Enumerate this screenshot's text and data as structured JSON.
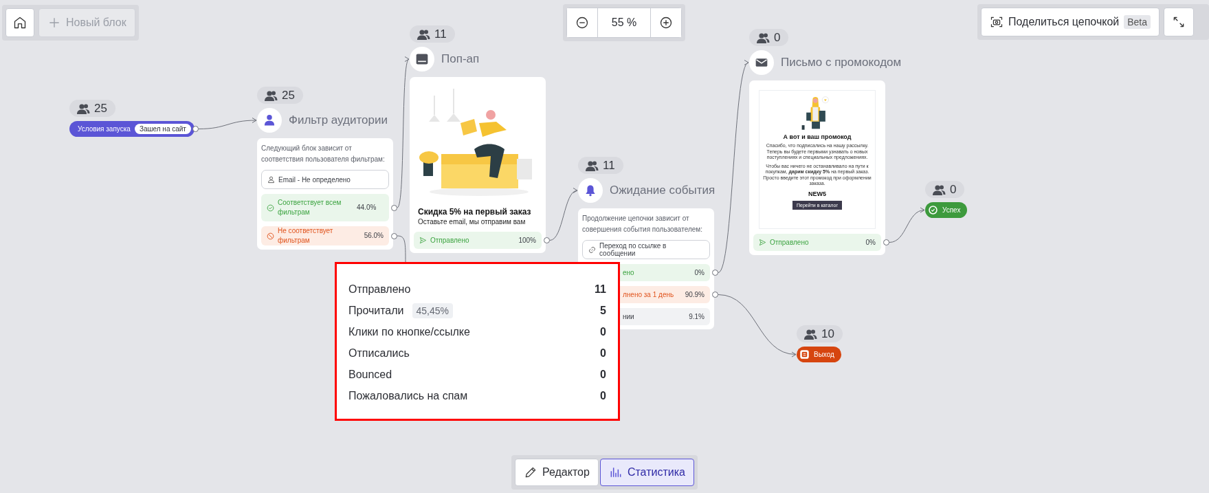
{
  "toolbar": {
    "new_block_button": {
      "label": "Новый блок",
      "disabled": true
    }
  },
  "zoom": {
    "value": "55 %"
  },
  "share": {
    "label": "Поделиться цепочкой",
    "badge": "Beta"
  },
  "nodes": [
    {
      "kind": "start",
      "count": "25",
      "label": "Условия запуска",
      "tag": "Зашел на сайт"
    },
    {
      "kind": "filter",
      "count": "25",
      "title": "Фильтр аудитории",
      "description": "Следующий блок зависит от соответствия пользователя фильтрам:",
      "condition": "Email - Не определено",
      "outcomes": [
        {
          "kind": "match",
          "label": "Соответствует всем фильтрам",
          "percent": "44.0%"
        },
        {
          "kind": "nomatch",
          "label": "Не соответствует фильтрам",
          "percent": "56.0%"
        }
      ]
    },
    {
      "kind": "popup",
      "count": "11",
      "title": "Поп-ап",
      "preview": {
        "kind": "picture",
        "heading": "Скидка 5% на первый заказ",
        "text": "Оставьте email, мы отправим вам"
      },
      "outcomes": [
        {
          "kind": "sent",
          "label": "Отправлено",
          "percent": "100%"
        }
      ]
    },
    {
      "kind": "wait",
      "count": "11",
      "title": "Ожидание события",
      "description": "Продолжение цепочки зависит от совершения события пользователем:",
      "condition": "Переход по ссылке в сообщении",
      "outcomes": [
        {
          "kind": "done",
          "label": "ено",
          "percent": "0%"
        },
        {
          "kind": "timeout",
          "label": "лнено за 1 день",
          "percent": "90.9%"
        },
        {
          "kind": "other",
          "label": "нии",
          "percent": "9.1%"
        }
      ]
    },
    {
      "kind": "email",
      "count": "0",
      "title": "Письмо с промокодом",
      "preview": {
        "kind": "picture",
        "heading": "А вот и ваш промокод",
        "paragraphs": [
          "Спасибо, что подписались на нашу рассылку. Теперь вы будете первыми узнавать о новых поступлениях и специальных предложениях.",
          "Чтобы вас ничего не останавливало на пути к покупкам, **дарим скидку 5%** на первый заказ. Просто введите этот промокод при оформлении заказа."
        ],
        "code": "NEW5",
        "button": "Перейти в каталог"
      },
      "outcomes": [
        {
          "kind": "sent",
          "label": "Отправлено",
          "percent": "0%"
        }
      ]
    },
    {
      "kind": "success",
      "count": "0",
      "label": "Успех"
    },
    {
      "kind": "exit",
      "count": "10",
      "label": "Выход"
    }
  ],
  "stats_popup": {
    "rows": [
      {
        "label": "Отправлено",
        "value": "11"
      },
      {
        "label": "Прочитали",
        "chip": "45,45%",
        "value": "5"
      },
      {
        "label": "Клики по кнопке/ссылке",
        "value": "0"
      },
      {
        "label": "Отписались",
        "value": "0"
      },
      {
        "label": "Bounced",
        "value": "0"
      },
      {
        "label": "Пожаловались на спам",
        "value": "0"
      }
    ]
  },
  "mode_tabs": [
    {
      "label": "Редактор",
      "selected": false,
      "kind": "edit"
    },
    {
      "label": "Статистика",
      "selected": true,
      "kind": "stats"
    }
  ]
}
